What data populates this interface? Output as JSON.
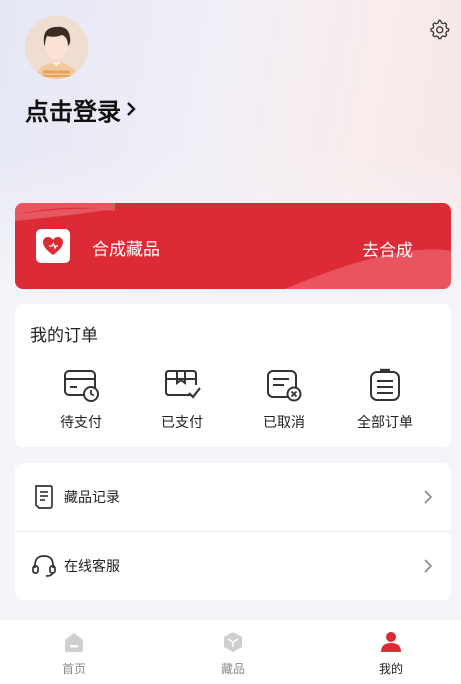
{
  "header": {
    "login_label": "点击登录",
    "settings_icon": "gear-icon",
    "avatar_icon": "user-avatar"
  },
  "synthesis": {
    "label": "合成藏品",
    "action": "去合成",
    "icon": "heart-box-icon",
    "color": "#dc2a36"
  },
  "orders": {
    "title": "我的订单",
    "items": [
      {
        "label": "待支付",
        "icon": "card-clock-icon"
      },
      {
        "label": "已支付",
        "icon": "box-check-icon"
      },
      {
        "label": "已取消",
        "icon": "receipt-cancel-icon"
      },
      {
        "label": "全部订单",
        "icon": "clipboard-list-icon"
      }
    ]
  },
  "menu": {
    "items": [
      {
        "label": "藏品记录",
        "icon": "document-icon"
      },
      {
        "label": "在线客服",
        "icon": "headset-icon"
      }
    ]
  },
  "tabbar": {
    "items": [
      {
        "label": "首页",
        "icon": "home-icon",
        "active": false
      },
      {
        "label": "藏品",
        "icon": "cube-icon",
        "active": false
      },
      {
        "label": "我的",
        "icon": "person-icon",
        "active": true
      }
    ],
    "active_color": "#dc2a36",
    "inactive_color": "#c9c9c9"
  }
}
